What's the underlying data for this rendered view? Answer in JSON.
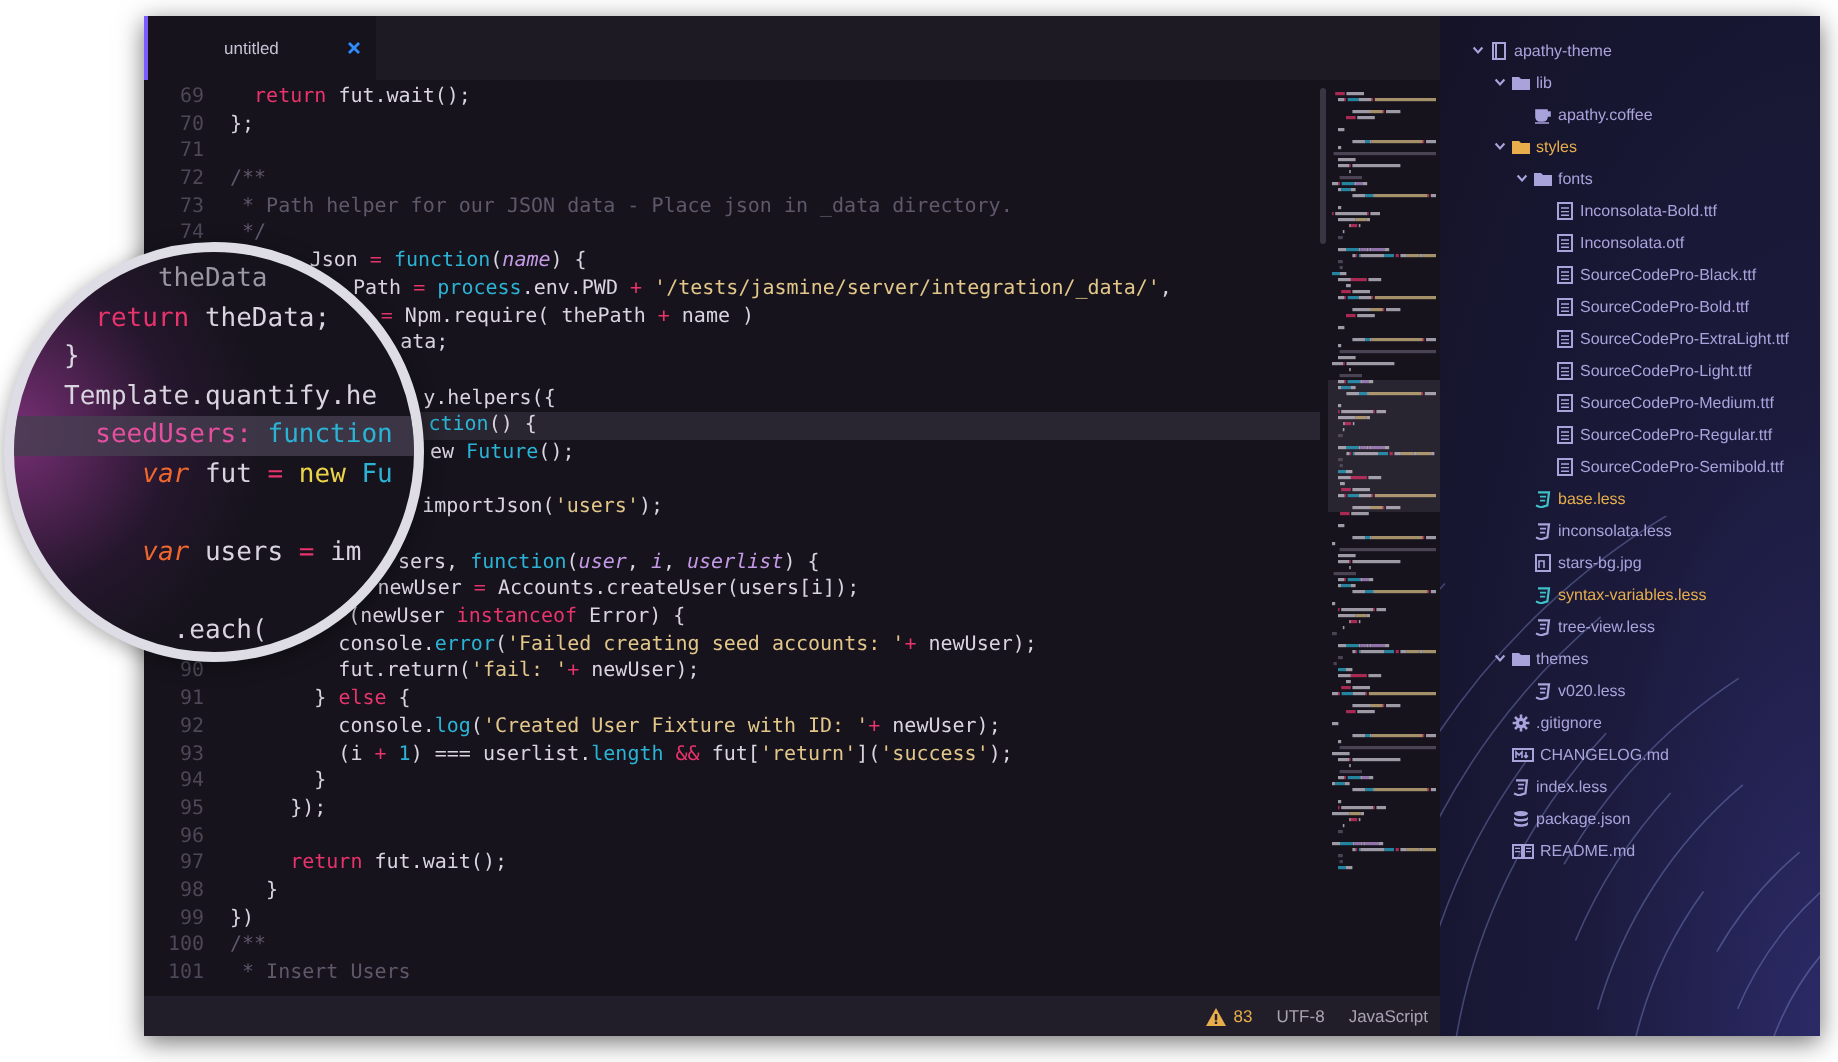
{
  "tab": {
    "label": "untitled",
    "selected": true
  },
  "editor": {
    "lines": [
      {
        "kind": "full",
        "number": "69",
        "cursor": false,
        "tokens": [
          {
            "text": "  return",
            "kind": "keyword"
          },
          {
            "text": " fut.wait();",
            "kind": "plain"
          }
        ]
      },
      {
        "kind": "full",
        "number": "70",
        "cursor": false,
        "tokens": [
          {
            "text": "};",
            "kind": "plain"
          }
        ]
      },
      {
        "kind": "full",
        "number": "71",
        "cursor": false
      },
      {
        "kind": "full",
        "number": "72",
        "cursor": false,
        "tokens": [
          {
            "text": "/**",
            "kind": "comment"
          }
        ]
      },
      {
        "kind": "full",
        "number": "73",
        "cursor": false,
        "tokens": [
          {
            "text": " * Path helper for our JSON data - Place json in _data directory.",
            "kind": "comment"
          }
        ]
      },
      {
        "kind": "full",
        "number": "74",
        "cursor": false,
        "tokens": [
          {
            "text": " */",
            "kind": "comment"
          }
        ]
      },
      {
        "kind": "partial",
        "cursor": false,
        "tokens": [
          {
            "text": "Json ",
            "kind": "plain"
          },
          {
            "text": "=",
            "kind": "operator"
          },
          {
            "text": " function",
            "kind": "builtin"
          },
          {
            "text": "(",
            "kind": "plain"
          },
          {
            "text": "name",
            "kind": "param"
          },
          {
            "text": ") {",
            "kind": "plain"
          }
        ]
      },
      {
        "kind": "partial",
        "cursor": false,
        "tokens": [
          {
            "text": "Path ",
            "kind": "plain"
          },
          {
            "text": "=",
            "kind": "operator"
          },
          {
            "text": " process",
            "kind": "builtin"
          },
          {
            "text": ".env.PWD ",
            "kind": "plain"
          },
          {
            "text": "+",
            "kind": "operator"
          },
          {
            "text": " '/tests/jasmine/server/integration/_data/'",
            "kind": "string"
          },
          {
            "text": ",",
            "kind": "plain"
          }
        ]
      },
      {
        "kind": "partial",
        "cursor": false,
        "tokens": [
          {
            "text": "=",
            "kind": "operator"
          },
          {
            "text": " Npm.require( thePath ",
            "kind": "plain"
          },
          {
            "text": "+",
            "kind": "operator"
          },
          {
            "text": " name )",
            "kind": "plain"
          }
        ]
      },
      {
        "kind": "partial",
        "cursor": false,
        "tokens": [
          {
            "text": "ata;",
            "kind": "plain"
          }
        ]
      },
      {
        "kind": "partial",
        "cursor": false
      },
      {
        "kind": "partial",
        "cursor": false,
        "tokens": [
          {
            "text": "y.helpers({",
            "kind": "plain"
          }
        ]
      },
      {
        "kind": "partial",
        "cursor": true,
        "tokens": [
          {
            "text": "ction",
            "kind": "builtin"
          },
          {
            "text": "() {",
            "kind": "plain"
          }
        ]
      },
      {
        "kind": "partial",
        "cursor": false,
        "tokens": [
          {
            "text": "ew ",
            "kind": "plain"
          },
          {
            "text": "Future",
            "kind": "builtin"
          },
          {
            "text": "();",
            "kind": "plain"
          }
        ]
      },
      {
        "kind": "partial",
        "cursor": false
      },
      {
        "kind": "partial",
        "cursor": false,
        "tokens": [
          {
            "text": "importJson(",
            "kind": "plain"
          },
          {
            "text": "'users'",
            "kind": "string"
          },
          {
            "text": ");",
            "kind": "plain"
          }
        ]
      },
      {
        "kind": "partial",
        "cursor": false
      },
      {
        "kind": "partial",
        "cursor": false,
        "tokens": [
          {
            "text": "sers, ",
            "kind": "plain"
          },
          {
            "text": "function",
            "kind": "builtin"
          },
          {
            "text": "(",
            "kind": "plain"
          },
          {
            "text": "user",
            "kind": "param"
          },
          {
            "text": ", ",
            "kind": "plain"
          },
          {
            "text": "i",
            "kind": "param"
          },
          {
            "text": ", ",
            "kind": "plain"
          },
          {
            "text": "userlist",
            "kind": "param"
          },
          {
            "text": ") {",
            "kind": "plain"
          }
        ]
      },
      {
        "kind": "partial",
        "cursor": false,
        "tokens": [
          {
            "text": "newUser ",
            "kind": "plain"
          },
          {
            "text": "=",
            "kind": "operator"
          },
          {
            "text": " Accounts.createUser(users[i]);",
            "kind": "plain"
          }
        ]
      },
      {
        "kind": "partial",
        "cursor": false,
        "tokens": [
          {
            "text": "(newUser ",
            "kind": "plain"
          },
          {
            "text": "instanceof",
            "kind": "keyword"
          },
          {
            "text": " Error) {",
            "kind": "plain"
          }
        ]
      },
      {
        "kind": "full",
        "cursor": false,
        "tokens": [
          {
            "text": "         console.",
            "kind": "plain"
          },
          {
            "text": "error",
            "kind": "builtin"
          },
          {
            "text": "(",
            "kind": "plain"
          },
          {
            "text": "'Failed creating seed accounts: '",
            "kind": "string"
          },
          {
            "text": "+",
            "kind": "operator"
          },
          {
            "text": " newUser);",
            "kind": "plain"
          }
        ]
      },
      {
        "kind": "full",
        "number": "90",
        "cursor": false,
        "tokens": [
          {
            "text": "         fut.return(",
            "kind": "plain"
          },
          {
            "text": "'fail: '",
            "kind": "string"
          },
          {
            "text": "+",
            "kind": "operator"
          },
          {
            "text": " newUser);",
            "kind": "plain"
          }
        ]
      },
      {
        "kind": "full",
        "number": "91",
        "cursor": false,
        "tokens": [
          {
            "text": "       } ",
            "kind": "plain"
          },
          {
            "text": "else",
            "kind": "keyword"
          },
          {
            "text": " {",
            "kind": "plain"
          }
        ]
      },
      {
        "kind": "full",
        "number": "92",
        "cursor": false,
        "tokens": [
          {
            "text": "         console.",
            "kind": "plain"
          },
          {
            "text": "log",
            "kind": "builtin"
          },
          {
            "text": "(",
            "kind": "plain"
          },
          {
            "text": "'Created User Fixture with ID: '",
            "kind": "string"
          },
          {
            "text": "+",
            "kind": "operator"
          },
          {
            "text": " newUser);",
            "kind": "plain"
          }
        ]
      },
      {
        "kind": "full",
        "number": "93",
        "cursor": false,
        "tokens": [
          {
            "text": "         (i ",
            "kind": "plain"
          },
          {
            "text": "+",
            "kind": "operator"
          },
          {
            "text": " 1",
            "kind": "builtin"
          },
          {
            "text": ") === userlist.",
            "kind": "plain"
          },
          {
            "text": "length",
            "kind": "builtin"
          },
          {
            "text": " &&",
            "kind": "operator"
          },
          {
            "text": " fut[",
            "kind": "plain"
          },
          {
            "text": "'return'",
            "kind": "string"
          },
          {
            "text": "](",
            "kind": "plain"
          },
          {
            "text": "'success'",
            "kind": "string"
          },
          {
            "text": ");",
            "kind": "plain"
          }
        ]
      },
      {
        "kind": "full",
        "number": "94",
        "cursor": false,
        "tokens": [
          {
            "text": "       }",
            "kind": "plain"
          }
        ]
      },
      {
        "kind": "full",
        "number": "95",
        "cursor": false,
        "tokens": [
          {
            "text": "     });",
            "kind": "plain"
          }
        ]
      },
      {
        "kind": "full",
        "number": "96",
        "cursor": false
      },
      {
        "kind": "full",
        "number": "97",
        "cursor": false,
        "tokens": [
          {
            "text": "     return",
            "kind": "keyword"
          },
          {
            "text": " fut.wait();",
            "kind": "plain"
          }
        ]
      },
      {
        "kind": "full",
        "number": "98",
        "cursor": false,
        "tokens": [
          {
            "text": "   }",
            "kind": "plain"
          }
        ]
      },
      {
        "kind": "full",
        "number": "99",
        "cursor": false,
        "tokens": [
          {
            "text": "})",
            "kind": "plain"
          }
        ]
      },
      {
        "kind": "full",
        "number": "100",
        "cursor": false,
        "tokens": [
          {
            "text": "/**",
            "kind": "comment"
          }
        ]
      },
      {
        "kind": "full",
        "number": "101",
        "cursor": false,
        "tokens": [
          {
            "text": " * Insert Users",
            "kind": "comment"
          }
        ]
      }
    ]
  },
  "magnifier": {
    "lines": [
      {
        "cursor": false,
        "tokens": [
          {
            "text": "      theData",
            "kind": "faded"
          }
        ]
      },
      {
        "cursor": false,
        "tokens": [
          {
            "text": "  return",
            "kind": "keyword"
          },
          {
            "text": " theData;",
            "kind": "plain"
          }
        ]
      },
      {
        "cursor": false,
        "tokens": [
          {
            "text": "}",
            "kind": "plain"
          }
        ]
      },
      {
        "cursor": false,
        "tokens": [
          {
            "text": "Template.quantify.he",
            "kind": "plain"
          }
        ]
      },
      {
        "cursor": true,
        "tokens": [
          {
            "text": "  seedUsers:",
            "kind": "key"
          },
          {
            "text": " function",
            "kind": "builtin"
          }
        ]
      },
      {
        "cursor": false,
        "tokens": [
          {
            "text": "     var",
            "kind": "storage"
          },
          {
            "text": " fut ",
            "kind": "plain"
          },
          {
            "text": "=",
            "kind": "operator"
          },
          {
            "text": " new",
            "kind": "constructor"
          },
          {
            "text": " Fu",
            "kind": "builtin"
          }
        ]
      },
      {
        "cursor": false
      },
      {
        "cursor": false,
        "tokens": [
          {
            "text": "     var",
            "kind": "storage"
          },
          {
            "text": " users ",
            "kind": "plain"
          },
          {
            "text": "=",
            "kind": "operator"
          },
          {
            "text": " im",
            "kind": "plain"
          }
        ]
      },
      {
        "cursor": false
      },
      {
        "cursor": false,
        "tokens": [
          {
            "text": "       .each(",
            "kind": "plain"
          }
        ]
      }
    ]
  },
  "status_bar": {
    "warnings": "83",
    "encoding": "UTF-8",
    "grammar": "JavaScript"
  },
  "tree": [
    {
      "kind": "repo",
      "name": "apathy-theme",
      "modified": false,
      "expanded": true,
      "children": [
        {
          "kind": "folder",
          "name": "lib",
          "modified": false,
          "expanded": true,
          "children": [
            {
              "kind": "coffee",
              "name": "apathy.coffee",
              "modified": false
            }
          ]
        },
        {
          "kind": "folder",
          "name": "styles",
          "modified": true,
          "expanded": true,
          "children": [
            {
              "kind": "folder",
              "name": "fonts",
              "modified": false,
              "expanded": true,
              "children": [
                {
                  "kind": "text",
                  "name": "Inconsolata-Bold.ttf",
                  "modified": false
                },
                {
                  "kind": "text",
                  "name": "Inconsolata.otf",
                  "modified": false
                },
                {
                  "kind": "text",
                  "name": "SourceCodePro-Black.ttf",
                  "modified": false
                },
                {
                  "kind": "text",
                  "name": "SourceCodePro-Bold.ttf",
                  "modified": false
                },
                {
                  "kind": "text",
                  "name": "SourceCodePro-ExtraLight.ttf",
                  "modified": false
                },
                {
                  "kind": "text",
                  "name": "SourceCodePro-Light.ttf",
                  "modified": false
                },
                {
                  "kind": "text",
                  "name": "SourceCodePro-Medium.ttf",
                  "modified": false
                },
                {
                  "kind": "text",
                  "name": "SourceCodePro-Regular.ttf",
                  "modified": false
                },
                {
                  "kind": "text",
                  "name": "SourceCodePro-Semibold.ttf",
                  "modified": false
                }
              ]
            },
            {
              "kind": "style",
              "name": "base.less",
              "modified": true
            },
            {
              "kind": "style",
              "name": "inconsolata.less",
              "modified": false
            },
            {
              "kind": "image",
              "name": "stars-bg.jpg",
              "modified": false
            },
            {
              "kind": "style",
              "name": "syntax-variables.less",
              "modified": true
            },
            {
              "kind": "style",
              "name": "tree-view.less",
              "modified": false
            }
          ]
        },
        {
          "kind": "folder",
          "name": "themes",
          "modified": false,
          "expanded": true,
          "children": [
            {
              "kind": "style",
              "name": "v020.less",
              "modified": false
            }
          ]
        },
        {
          "kind": "config",
          "name": ".gitignore",
          "modified": false
        },
        {
          "kind": "markdown",
          "name": "CHANGELOG.md",
          "modified": false
        },
        {
          "kind": "style",
          "name": "index.less",
          "modified": false
        },
        {
          "kind": "package",
          "name": "package.json",
          "modified": false
        },
        {
          "kind": "readme",
          "name": "README.md",
          "modified": false
        }
      ]
    }
  ]
}
